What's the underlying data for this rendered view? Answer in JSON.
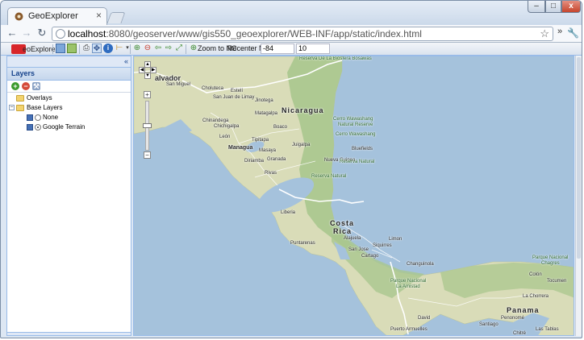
{
  "browser": {
    "tab_title": "GeoExplorer",
    "tab_close": "×",
    "back_icon": "←",
    "forward_icon": "→",
    "reload_icon": "↻",
    "url_host": "localhost",
    "url_rest": ":8080/geoserver/www/gis550_geoexplorer/WEB-INF/app/static/index.html",
    "star_icon": "☆",
    "more_icon": "»",
    "wrench_icon": "🔧",
    "min_icon": "–",
    "max_icon": "□",
    "close_icon": "x"
  },
  "toolbar": {
    "logo_text": "eoExplorer",
    "zoom_to_label": "Zoom to NC",
    "recenter_label": "Recenter Map:",
    "lon_value": "-84",
    "zoom_value": "10"
  },
  "layers_panel": {
    "collapse": "«",
    "title": "Layers",
    "overlays": "Overlays",
    "base_layers": "Base Layers",
    "none": "None",
    "google_terrain": "Google Terrain",
    "expander_minus": "−"
  },
  "map": {
    "labels": {
      "salvador": "alvador",
      "san_miguel": "San Miguel",
      "choluteca": "Choluteca",
      "reserva_bosawas": "Reserva De La Biosfera Bosawas",
      "esteli": "Estelí",
      "san_juan_limay": "San Juan de Limay",
      "jinotega": "Jinotega",
      "nicaragua": "Nicaragua",
      "chinandega": "Chinandega",
      "chichigalpa": "Chichigalpa",
      "matagalpa": "Matagalpa",
      "leon": "León",
      "boaco": "Boaco",
      "cerro_wawashang": "Cerro Wawashang",
      "natural_reserve": "Natural Reserve",
      "cerro_wawashang2": "Cerro Wawashang",
      "managua": "Managua",
      "tipitapa": "Tipitapa",
      "masaya": "Masaya",
      "juigalpa": "Juigalpa",
      "diriamba": "Diriamba",
      "granada": "Granada",
      "bluefields": "Bluefields",
      "nueva_guinea": "Nueva Guinea",
      "reserva_natural": "Reserva Natural",
      "rivas": "Rivas",
      "reserva_natural2": "Reserva Natural",
      "liberia": "Liberia",
      "costa": "Costa",
      "rica": "Rica",
      "alajuela": "Alajuela",
      "limon": "Limon",
      "puntarenas": "Puntarenas",
      "san_jose": "San Jose",
      "cartago": "Cartago",
      "siquirres": "Siquirres",
      "changuinola": "Changuinola",
      "parque_nacional": "Parque Nacional",
      "la_amistad": "La Amistad",
      "parque_nacional2": "Parque Nacional",
      "chagres": "Chagres",
      "colon": "Colón",
      "panama": "Panama",
      "david": "David",
      "puerto_armuelles": "Puerto Armuelles",
      "santiago": "Santiago",
      "penonome": "Penonomé",
      "chitre": "Chitré",
      "las_tablas": "Las Tablas",
      "la_chorrera": "La Chorrera",
      "tocumen": "Tocumen"
    },
    "zoom_in": "+",
    "zoom_out": "−"
  }
}
